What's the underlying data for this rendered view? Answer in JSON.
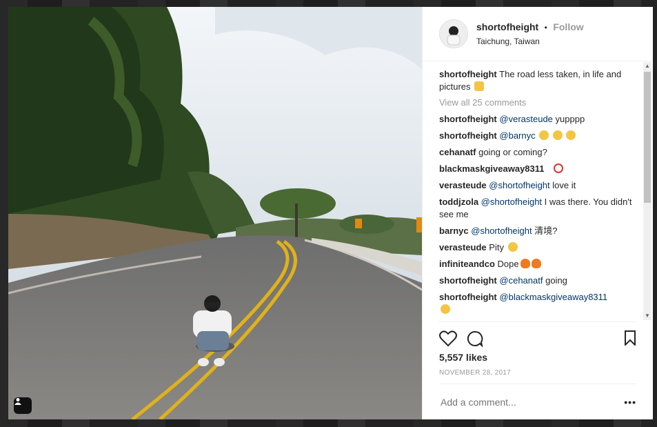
{
  "post": {
    "username": "shortofheight",
    "separator": "•",
    "follow_label": "Follow",
    "location": "Taichung, Taiwan"
  },
  "caption": {
    "user": "shortofheight",
    "text": "The road less taken, in life and pictures",
    "emoji": "flexed-biceps"
  },
  "view_all_label": "View all 25 comments",
  "comments": [
    {
      "user": "shortofheight",
      "mention": "@verasteude",
      "text": "yupppp"
    },
    {
      "user": "shortofheight",
      "mention": "@barnyc",
      "text": "",
      "emoji": "grimacing x3"
    },
    {
      "user": "cehanatf",
      "mention": "",
      "text": "going or coming?"
    },
    {
      "user": "blackmaskgiveaway8311",
      "mention": "",
      "text": "",
      "emoji": "no-smoking"
    },
    {
      "user": "verasteude",
      "mention": "@shortofheight",
      "text": "love it"
    },
    {
      "user": "toddjzola",
      "mention": "@shortofheight",
      "text": "I was there. You didn't see me"
    },
    {
      "user": "barnyc",
      "mention": "@shortofheight",
      "text": "清境?"
    },
    {
      "user": "verasteude",
      "mention": "",
      "text": "Pity",
      "emoji": "sunglasses"
    },
    {
      "user": "infiniteandco",
      "mention": "",
      "text": "Dope",
      "emoji": "fire x2"
    },
    {
      "user": "shortofheight",
      "mention": "@cehanatf",
      "text": "going"
    },
    {
      "user": "shortofheight",
      "mention": "@blackmaskgiveaway8311",
      "text": "",
      "emoji": "confused"
    }
  ],
  "likes": "5,557 likes",
  "date": "NOVEMBER 28, 2017",
  "add_comment_placeholder": "Add a comment...",
  "more_label": "•••",
  "colors": {
    "mention": "#003569",
    "muted": "#999999",
    "text": "#262626"
  }
}
